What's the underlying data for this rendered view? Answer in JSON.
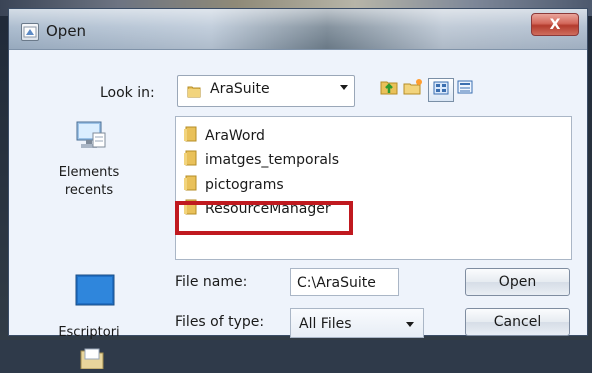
{
  "window": {
    "title": "Open",
    "close_glyph": "X"
  },
  "look_in": {
    "label": "Look in:",
    "value": "AraSuite"
  },
  "places": [
    {
      "label": "Elements recents"
    },
    {
      "label": "Escriptori"
    },
    {
      "label": ""
    }
  ],
  "files": [
    {
      "name": "AraWord"
    },
    {
      "name": "imatges_temporals"
    },
    {
      "name": "pictograms"
    },
    {
      "name": "ResourceManager"
    }
  ],
  "file_name": {
    "label": "File name:",
    "value": "C:\\AraSuite"
  },
  "files_of_type": {
    "label": "Files of type:",
    "value": "All Files"
  },
  "buttons": {
    "open": "Open",
    "cancel": "Cancel"
  },
  "colors": {
    "highlight_box": "#c0191f",
    "folder": "#e9c15a"
  },
  "icons": {
    "toolbar": [
      "up-folder-icon",
      "new-folder-icon",
      "list-view-icon",
      "details-view-icon"
    ]
  }
}
